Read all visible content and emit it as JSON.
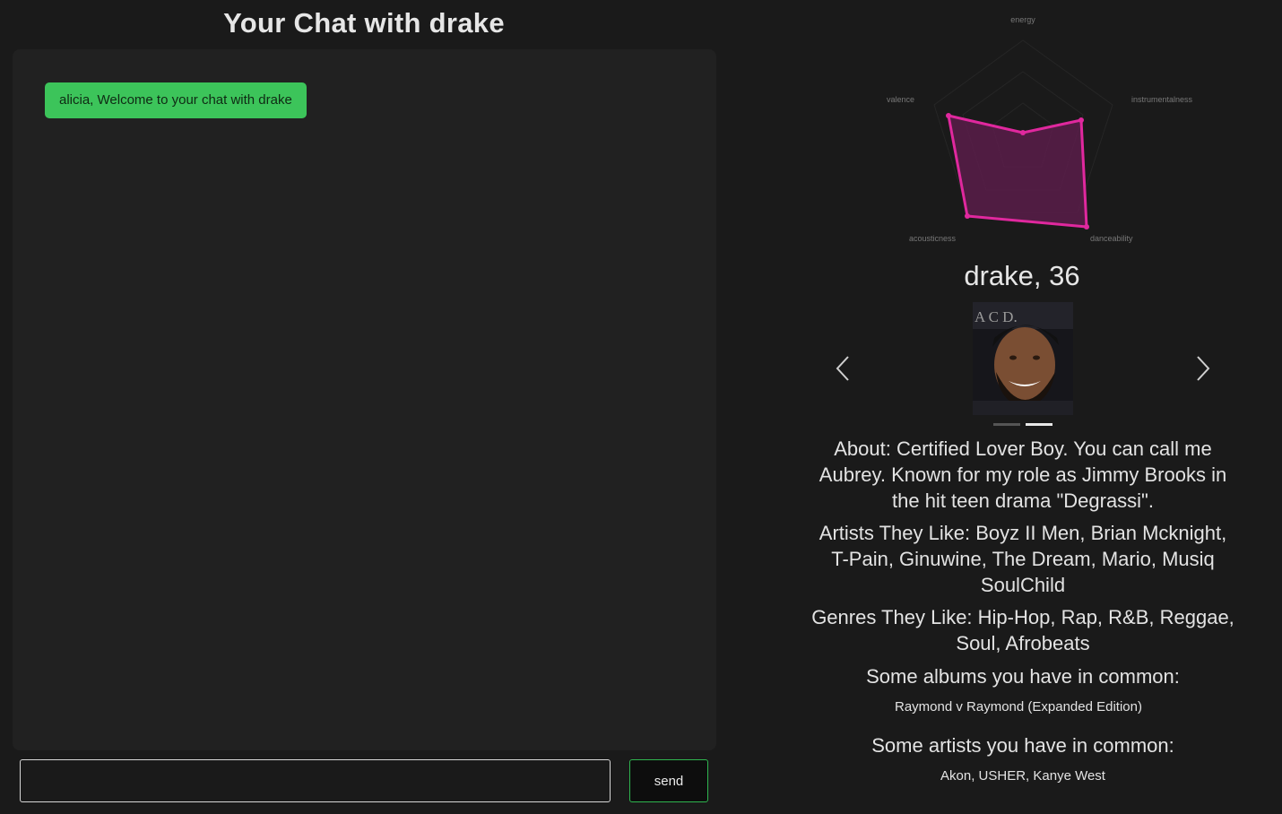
{
  "chat": {
    "title": "Your Chat with drake",
    "messages": [
      {
        "text": "alicia, Welcome to your chat with drake"
      }
    ],
    "input_value": "",
    "send_label": "send"
  },
  "radar": {
    "labels": {
      "energy": "energy",
      "instrumentalness": "instrumentalness",
      "danceability": "danceability",
      "acousticness": "acousticness",
      "valence": "valence"
    },
    "stroke_color": "#e0289e"
  },
  "profile": {
    "name_age": "drake, 36",
    "carousel": {
      "active_index": 1,
      "count": 2
    },
    "about": "About: Certified Lover Boy. You can call me Aubrey. Known for my role as Jimmy Brooks in the hit teen drama \"Degrassi\".",
    "artists": "Artists They Like: Boyz II Men, Brian Mcknight, T-Pain, Ginuwine, The Dream, Mario, Musiq SoulChild",
    "genres": "Genres They Like: Hip-Hop, Rap, R&B, Reggae, Soul, Afrobeats",
    "albums_heading": "Some albums you have in common:",
    "albums_value": "Raymond v Raymond (Expanded Edition)",
    "common_artists_heading": "Some artists you have in common:",
    "common_artists_value": "Akon,  USHER,  Kanye West"
  }
}
